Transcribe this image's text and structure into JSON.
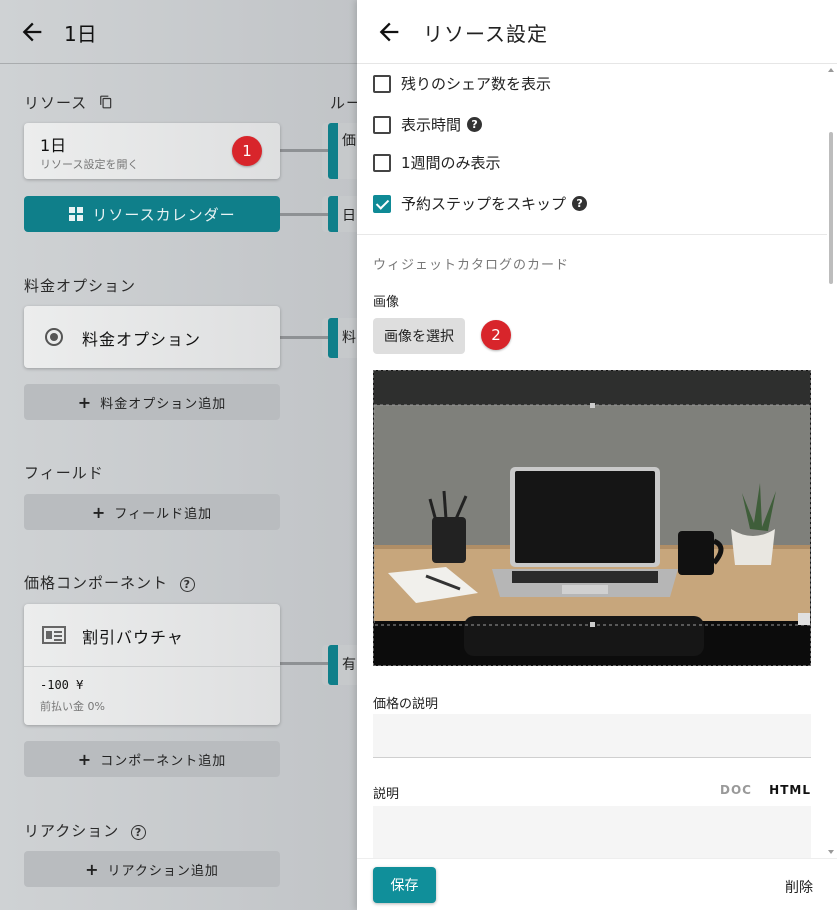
{
  "background": {
    "title": "1日",
    "resource_label": "リソース",
    "route_label": "ルー",
    "resource_card": {
      "title": "1日",
      "subtitle": "リソース設定を開く",
      "badge": "1"
    },
    "resource_calendar_button": "リソースカレンダー",
    "pricing_options_label": "料金オプション",
    "pricing_option_card": "料金オプション",
    "add_pricing_option": "料金オプション追加",
    "fields_label": "フィールド",
    "add_field": "フィールド追加",
    "price_components_label": "価格コンポーネント",
    "discount_card": {
      "title": "割引バウチャ",
      "amount": "-100 ¥",
      "prepay": "前払い金 0%"
    },
    "add_component": "コンポーネント追加",
    "reactions_label": "リアクション",
    "add_reaction": "リアクション追加",
    "route_tab_chars": [
      "価",
      "日",
      "料",
      "有"
    ]
  },
  "drawer": {
    "title": "リソース設定",
    "checkboxes": [
      {
        "label": "残りのシェア数を表示",
        "checked": false,
        "help": false
      },
      {
        "label": "表示時間",
        "checked": false,
        "help": true
      },
      {
        "label": "1週間のみ表示",
        "checked": false,
        "help": false
      },
      {
        "label": "予約ステップをスキップ",
        "checked": true,
        "help": true
      }
    ],
    "catalog_section": "ウィジェットカタログのカード",
    "image_label": "画像",
    "select_image_button": "画像を選択",
    "badge2": "2",
    "price_description_label": "価格の説明",
    "description_label": "説明",
    "editor_modes": {
      "doc": "DOC",
      "html": "HTML"
    },
    "save_button": "保存",
    "delete_button": "削除"
  },
  "colors": {
    "teal": "#0f7f8a",
    "badge_red": "#d8252b"
  }
}
